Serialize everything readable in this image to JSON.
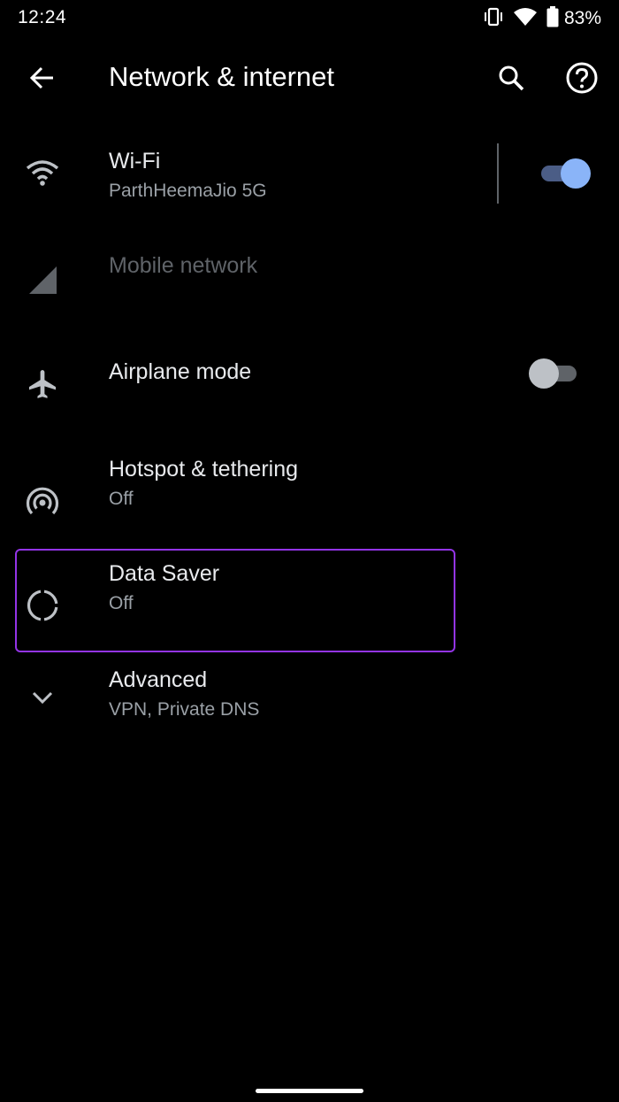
{
  "status_bar": {
    "time": "12:24",
    "battery_percent": "83%",
    "icons": [
      "vibrate-icon",
      "wifi-signal-icon",
      "battery-icon"
    ]
  },
  "app_bar": {
    "title": "Network & internet",
    "icons": [
      "back-arrow-icon",
      "search-icon",
      "help-icon"
    ]
  },
  "settings": {
    "wifi": {
      "title": "Wi-Fi",
      "summary": "ParthHeemaJio 5G",
      "enabled": true,
      "icon": "wifi-icon"
    },
    "mobile": {
      "title": "Mobile network",
      "disabled": true,
      "icon": "cell-signal-icon"
    },
    "airplane": {
      "title": "Airplane mode",
      "enabled": false,
      "icon": "airplane-icon"
    },
    "hotspot": {
      "title": "Hotspot & tethering",
      "summary": "Off",
      "icon": "hotspot-icon"
    },
    "data_saver": {
      "title": "Data Saver",
      "summary": "Off",
      "icon": "data-saver-icon",
      "highlighted": true
    },
    "advanced": {
      "title": "Advanced",
      "summary": "VPN, Private DNS",
      "icon": "chevron-down-icon"
    }
  },
  "colors": {
    "background": "#000000",
    "accent": "#8ab4f8",
    "highlight": "#9334e6",
    "text_primary": "#e8eaed",
    "text_secondary": "#9aa0a6"
  }
}
